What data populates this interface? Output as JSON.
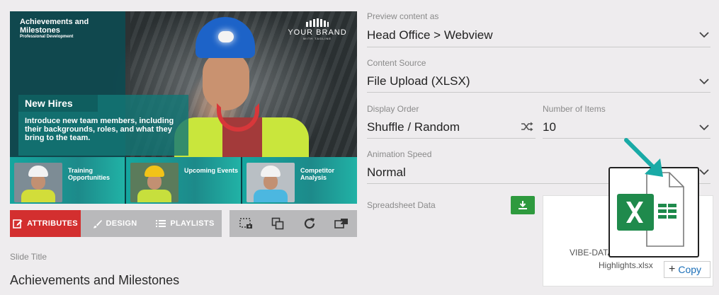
{
  "preview": {
    "title": "Achievements and Milestones",
    "subtitle": "Professional Development",
    "brand_name": "YOUR BRAND",
    "brand_tagline": "WITH TAGLINE",
    "new_hires_heading": "New Hires",
    "new_hires_body": "Introduce new team members, including their backgrounds, roles, and what they bring to the team.",
    "tiles": [
      {
        "label": "Training Opportunities",
        "helmet": "#f2f2f2",
        "body": "#d2dd3a"
      },
      {
        "label": "Upcoming Events",
        "helmet": "#f2c318",
        "body": "#c7df3d"
      },
      {
        "label": "Competitor Analysis",
        "helmet": "#f2f2f2",
        "body": "#4cb7e0"
      }
    ]
  },
  "tabs": {
    "attributes": "ATTRIBUTES",
    "design": "DESIGN",
    "playlists": "PLAYLISTS"
  },
  "tools": [
    "screenshot-icon",
    "layers-icon",
    "refresh-icon",
    "cast-icon"
  ],
  "slide_title": {
    "label": "Slide Title",
    "value": "Achievements and Milestones"
  },
  "form": {
    "preview_as": {
      "label": "Preview content as",
      "value": "Head Office > Webview"
    },
    "content_source": {
      "label": "Content Source",
      "value": "File Upload (XLSX)"
    },
    "display_order": {
      "label": "Display Order",
      "value": "Shuffle / Random"
    },
    "number_of_items": {
      "label": "Number of Items",
      "value": "10"
    },
    "animation_speed": {
      "label": "Animation Speed",
      "value": "Normal"
    },
    "spreadsheet": {
      "label": "Spreadsheet Data",
      "file_name_line1": "VIBE-DATA",
      "file_name_line2": "Highlights.xlsx",
      "copy_label": "Copy"
    }
  },
  "colors": {
    "accent_red": "#d32f2f",
    "download_green": "#2e9a3e",
    "excel_green": "#1f8a4c",
    "arrow_teal": "#19aaa6",
    "link_blue": "#1b6fb8"
  }
}
